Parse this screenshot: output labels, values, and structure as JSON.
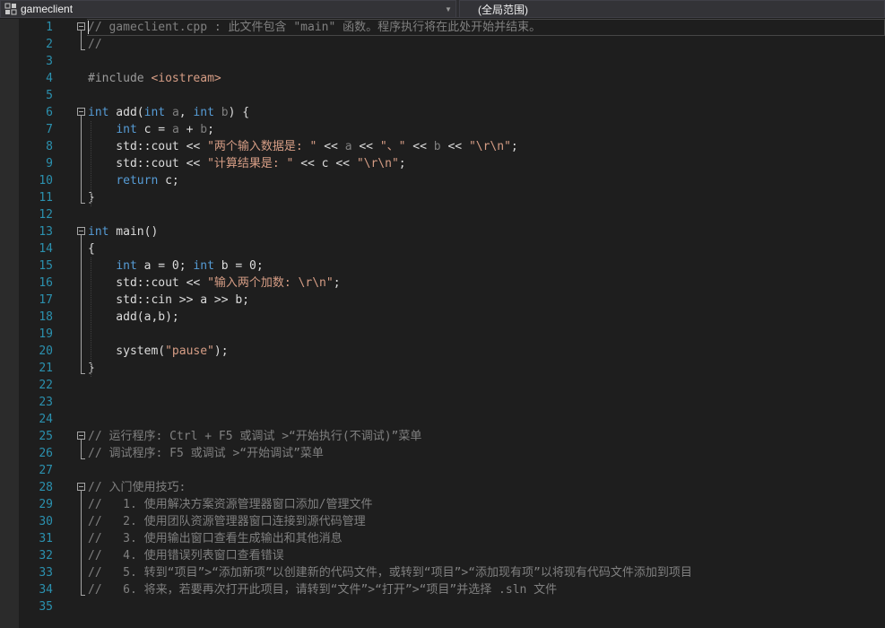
{
  "navbar": {
    "project_label": "gameclient",
    "scope_label": "(全局范围)",
    "project_icon": "project-icon",
    "dropdown_icon": "chevron-down-icon"
  },
  "colors": {
    "line_number": "#2b91af",
    "keyword": "#569cd6",
    "comment": "#808080",
    "string": "#d69d85",
    "text": "#dcdcdc",
    "background": "#1e1e1e"
  },
  "current_line": 1,
  "lines": [
    {
      "n": "1",
      "fold": "start",
      "tokens": [
        {
          "t": "// gameclient.cpp : 此文件包含 \"main\" 函数。程序执行将在此处开始并结束。",
          "c": "cm"
        }
      ]
    },
    {
      "n": "2",
      "tokens": [
        {
          "t": "//",
          "c": "cm"
        }
      ]
    },
    {
      "n": "3",
      "tokens": []
    },
    {
      "n": "4",
      "tokens": [
        {
          "t": "#include ",
          "c": "pp"
        },
        {
          "t": "<iostream>",
          "c": "st"
        }
      ]
    },
    {
      "n": "5",
      "tokens": []
    },
    {
      "n": "6",
      "fold": "start",
      "tokens": [
        {
          "t": "int",
          "c": "kw"
        },
        {
          "t": " add("
        },
        {
          "t": "int",
          "c": "kw"
        },
        {
          "t": " "
        },
        {
          "t": "a",
          "c": "pr"
        },
        {
          "t": ", "
        },
        {
          "t": "int",
          "c": "kw"
        },
        {
          "t": " "
        },
        {
          "t": "b",
          "c": "pr"
        },
        {
          "t": ") {"
        }
      ]
    },
    {
      "n": "7",
      "tokens": [
        {
          "t": "    "
        },
        {
          "t": "int",
          "c": "kw"
        },
        {
          "t": " c = "
        },
        {
          "t": "a",
          "c": "pr"
        },
        {
          "t": " + "
        },
        {
          "t": "b",
          "c": "pr"
        },
        {
          "t": ";"
        }
      ]
    },
    {
      "n": "8",
      "tokens": [
        {
          "t": "    std::cout << "
        },
        {
          "t": "\"两个输入数据是: \"",
          "c": "st"
        },
        {
          "t": " << "
        },
        {
          "t": "a",
          "c": "pr"
        },
        {
          "t": " << "
        },
        {
          "t": "\"、\"",
          "c": "st"
        },
        {
          "t": " << "
        },
        {
          "t": "b",
          "c": "pr"
        },
        {
          "t": " << "
        },
        {
          "t": "\"\\r\\n\"",
          "c": "st"
        },
        {
          "t": ";"
        }
      ]
    },
    {
      "n": "9",
      "tokens": [
        {
          "t": "    std::cout << "
        },
        {
          "t": "\"计算结果是: \"",
          "c": "st"
        },
        {
          "t": " << c << "
        },
        {
          "t": "\"\\r\\n\"",
          "c": "st"
        },
        {
          "t": ";"
        }
      ]
    },
    {
      "n": "10",
      "tokens": [
        {
          "t": "    "
        },
        {
          "t": "return",
          "c": "kw"
        },
        {
          "t": " c;"
        }
      ]
    },
    {
      "n": "11",
      "fold": "end",
      "tokens": [
        {
          "t": "}"
        }
      ]
    },
    {
      "n": "12",
      "tokens": []
    },
    {
      "n": "13",
      "fold": "start",
      "tokens": [
        {
          "t": "int",
          "c": "kw"
        },
        {
          "t": " main()"
        }
      ]
    },
    {
      "n": "14",
      "tokens": [
        {
          "t": "{"
        }
      ]
    },
    {
      "n": "15",
      "tokens": [
        {
          "t": "    "
        },
        {
          "t": "int",
          "c": "kw"
        },
        {
          "t": " a = 0; "
        },
        {
          "t": "int",
          "c": "kw"
        },
        {
          "t": " b = 0;"
        }
      ]
    },
    {
      "n": "16",
      "tokens": [
        {
          "t": "    std::cout << "
        },
        {
          "t": "\"输入两个加数: \\r\\n\"",
          "c": "st"
        },
        {
          "t": ";"
        }
      ]
    },
    {
      "n": "17",
      "tokens": [
        {
          "t": "    std::cin >> a >> b;"
        }
      ]
    },
    {
      "n": "18",
      "tokens": [
        {
          "t": "    add(a,b);"
        }
      ]
    },
    {
      "n": "19",
      "tokens": []
    },
    {
      "n": "20",
      "tokens": [
        {
          "t": "    system("
        },
        {
          "t": "\"pause\"",
          "c": "st"
        },
        {
          "t": ");"
        }
      ]
    },
    {
      "n": "21",
      "fold": "end",
      "tokens": [
        {
          "t": "}"
        }
      ]
    },
    {
      "n": "22",
      "tokens": []
    },
    {
      "n": "23",
      "tokens": []
    },
    {
      "n": "24",
      "tokens": []
    },
    {
      "n": "25",
      "fold": "start",
      "tokens": [
        {
          "t": "// 运行程序: Ctrl + F5 或调试 >“开始执行(不调试)”菜单",
          "c": "cm"
        }
      ]
    },
    {
      "n": "26",
      "tokens": [
        {
          "t": "// 调试程序: F5 或调试 >“开始调试”菜单",
          "c": "cm"
        }
      ]
    },
    {
      "n": "27",
      "tokens": []
    },
    {
      "n": "28",
      "fold": "start",
      "tokens": [
        {
          "t": "// 入门使用技巧:",
          "c": "cm"
        }
      ]
    },
    {
      "n": "29",
      "tokens": [
        {
          "t": "//   1. 使用解决方案资源管理器窗口添加/管理文件",
          "c": "cm"
        }
      ]
    },
    {
      "n": "30",
      "tokens": [
        {
          "t": "//   2. 使用团队资源管理器窗口连接到源代码管理",
          "c": "cm"
        }
      ]
    },
    {
      "n": "31",
      "tokens": [
        {
          "t": "//   3. 使用输出窗口查看生成输出和其他消息",
          "c": "cm"
        }
      ]
    },
    {
      "n": "32",
      "tokens": [
        {
          "t": "//   4. 使用错误列表窗口查看错误",
          "c": "cm"
        }
      ]
    },
    {
      "n": "33",
      "tokens": [
        {
          "t": "//   5. 转到“项目”>“添加新项”以创建新的代码文件，或转到“项目”>“添加现有项”以将现有代码文件添加到项目",
          "c": "cm"
        }
      ]
    },
    {
      "n": "34",
      "tokens": [
        {
          "t": "//   6. 将来，若要再次打开此项目，请转到“文件”>“打开”>“项目”并选择 .sln 文件",
          "c": "cm"
        }
      ]
    },
    {
      "n": "35",
      "tokens": []
    }
  ]
}
